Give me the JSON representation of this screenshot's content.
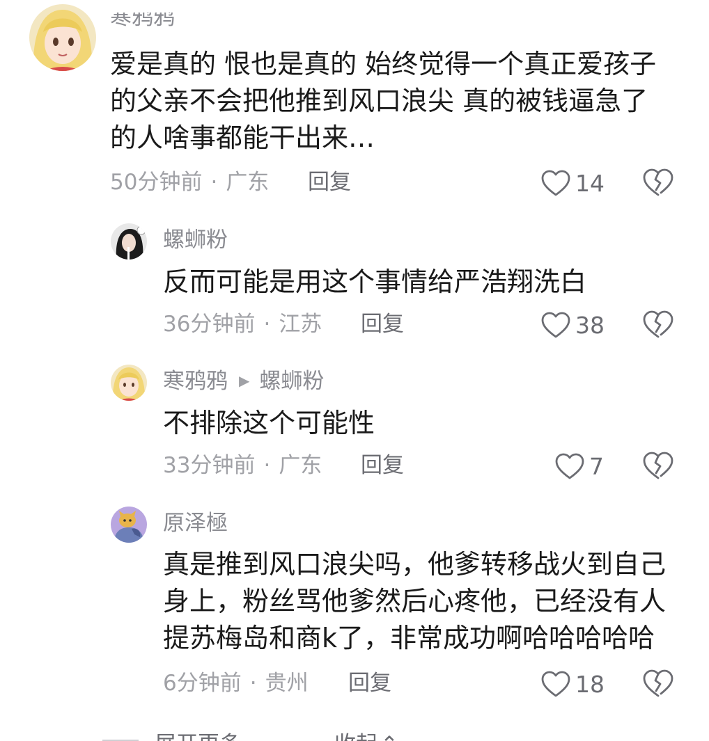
{
  "comments": [
    {
      "username": "寒鸦鸦",
      "lines": [
        "爱是真的 恨也是真的 始终觉得一个真正爱孩子",
        "的父亲不会把他推到风口浪尖 真的被钱逼急了",
        "的人啥事都能干出来…"
      ],
      "time": "50分钟前",
      "location": "广东",
      "reply_label": "回复",
      "likes": "14"
    },
    {
      "username": "螺蛳粉",
      "lines": [
        "反而可能是用这个事情给严浩翔洗白"
      ],
      "time": "36分钟前",
      "location": "江苏",
      "reply_label": "回复",
      "likes": "38"
    },
    {
      "username": "寒鸦鸦",
      "reply_to": "螺蛳粉",
      "lines": [
        "不排除这个可能性"
      ],
      "time": "33分钟前",
      "location": "广东",
      "reply_label": "回复",
      "likes": "7"
    },
    {
      "username": "原泽極",
      "lines": [
        "真是推到风口浪尖吗，他爹转移战火到自己",
        "身上，粉丝骂他爹然后心疼他，已经没有人",
        "提苏梅岛和商k了，非常成功啊哈哈哈哈哈"
      ],
      "time": "6分钟前",
      "location": "贵州",
      "reply_label": "回复",
      "likes": "18"
    }
  ],
  "footer": {
    "expand_label": "展开更多",
    "collapse_label": "收起"
  },
  "colors": {
    "text": "#1a1a1a",
    "meta": "#a0a1a6",
    "username": "#8a8b91",
    "icon": "#6b6c72"
  },
  "icons": [
    "heart-outline-icon",
    "broken-heart-icon",
    "chevron-down-icon",
    "chevron-up-icon",
    "triangle-right-icon"
  ]
}
